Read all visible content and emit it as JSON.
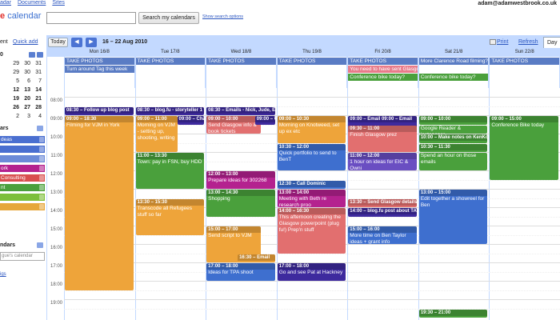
{
  "topnav": {
    "links": [
      "adar",
      "Documents",
      "Sites"
    ],
    "user_email": "adam@adamwestbrook.co.uk"
  },
  "header": {
    "logo_g": "e",
    "logo_text": "calendar",
    "search_button": "Search my calendars",
    "search_options": "Show search options"
  },
  "left": {
    "top_left": "ent",
    "quick_add": "Quick add",
    "mini_month": "0",
    "mini_rows": [
      [
        "29",
        "30",
        "31"
      ],
      [
        "29",
        "30",
        "31"
      ],
      [
        "5",
        "6",
        "7"
      ],
      [
        "12",
        "13",
        "14"
      ],
      [
        "19",
        "20",
        "21"
      ],
      [
        "26",
        "27",
        "28"
      ],
      [
        "2",
        "3",
        "4"
      ]
    ],
    "section_my": "ars",
    "calendars": [
      {
        "label": "deas",
        "color": "#4a6fd0"
      },
      {
        "label": "",
        "color": "#4a6fd0"
      },
      {
        "label": "",
        "color": "#6c8bd8"
      },
      {
        "label": "ork",
        "color": "#b4228f"
      },
      {
        "label": "Consulting",
        "color": "#d94f4f"
      },
      {
        "label": "nt",
        "color": "#4aa03c"
      },
      {
        "label": "",
        "color": "#7cbf3b"
      },
      {
        "label": "",
        "color": "#e6a73a"
      }
    ],
    "section_other": "ndars",
    "other_placeholder": "gue's calendar",
    "settings_link": "igs"
  },
  "toolbar": {
    "today": "Today",
    "prev": "◀",
    "next": "▶",
    "date_range": "16 – 22 Aug 2010",
    "print": "Print",
    "refresh": "Refresh",
    "day_tab": "Day"
  },
  "days": [
    "Mon 16/8",
    "Tue 17/8",
    "Wed 18/8",
    "Thu 19/8",
    "Fri 20/8",
    "Sat 21/8",
    "Sun 22/8"
  ],
  "times": [
    "08:00",
    "09:00",
    "10:00",
    "11:00",
    "12:00",
    "13:00",
    "14:00",
    "15:00",
    "16:00",
    "17:00",
    "18:00",
    "19:00"
  ],
  "allday": [
    {
      "day": 0,
      "row": 0,
      "text": "TAKE PHOTOS",
      "color": "#5a7cc4"
    },
    {
      "day": 0,
      "row": 1,
      "text": "Turn around Tag this week",
      "color": "#5a7cc4"
    },
    {
      "day": 1,
      "row": 0,
      "text": "TAKE PHOTOS",
      "color": "#5a7cc4"
    },
    {
      "day": 2,
      "row": 0,
      "text": "TAKE PHOTOS",
      "color": "#5a7cc4"
    },
    {
      "day": 3,
      "row": 0,
      "text": "TAKE PHOTOS",
      "color": "#5a7cc4"
    },
    {
      "day": 4,
      "row": 0,
      "text": "TAKE PHOTOS",
      "color": "#5a7cc4"
    },
    {
      "day": 4,
      "row": 1,
      "text": "You need to have sent Glasgow",
      "color": "#e87b8a"
    },
    {
      "day": 4,
      "row": 2,
      "text": "Conference bike today?",
      "color": "#4aa03c"
    },
    {
      "day": 5,
      "row": 0,
      "text": "More Clarence Road filming?",
      "color": "#5a7cc4"
    },
    {
      "day": 5,
      "row": 2,
      "text": "Conference bike today?",
      "color": "#4aa03c"
    },
    {
      "day": 6,
      "row": 0,
      "text": "TAKE PHOTOS",
      "color": "#5a7cc4"
    }
  ],
  "events": [
    {
      "day": 0,
      "start": 8.5,
      "end": 9.0,
      "hdr": "08:30 – Follow up blog post",
      "body": "",
      "color": "#3e2a9e"
    },
    {
      "day": 0,
      "start": 9.0,
      "end": 18.5,
      "hdr": "09:00 – 18:30",
      "body": "Filming for VJM in York",
      "color": "#eea43a"
    },
    {
      "day": 1,
      "start": 8.5,
      "end": 9.0,
      "hdr": "08:30 – blog.fu - storyteller 1",
      "body": "",
      "color": "#3e2a9e"
    },
    {
      "day": 1,
      "start": 9.0,
      "end": 11.0,
      "hdr": "09:00 – 11:00",
      "body": "Morning on VJM - setting up, shooting, writing",
      "color": "#eea43a",
      "w": 0.62
    },
    {
      "day": 1,
      "start": 9.0,
      "end": 9.5,
      "hdr": "09:00 – Chase E",
      "body": "",
      "color": "#3e2a9e",
      "x": 0.6,
      "w": 0.4
    },
    {
      "day": 1,
      "start": 11.0,
      "end": 13.0,
      "hdr": "11:00 – 13:30",
      "body": "Town: pay in FSN, buy HDD",
      "color": "#4aa03c"
    },
    {
      "day": 1,
      "start": 13.5,
      "end": 15.5,
      "hdr": "13:30 – 15:30",
      "body": "Transcode all Refugees stuff so far",
      "color": "#eea43a"
    },
    {
      "day": 2,
      "start": 8.5,
      "end": 9.0,
      "hdr": "08:30 – Emails - Nick, Jude, Est",
      "body": "",
      "color": "#3e2a9e"
    },
    {
      "day": 2,
      "start": 9.0,
      "end": 10.0,
      "hdr": "09:00 – 10:00",
      "body": "Send Glasgow info & book tickets",
      "color": "#e26f6f",
      "w": 0.8
    },
    {
      "day": 2,
      "start": 9.0,
      "end": 9.5,
      "hdr": "09:00 – Chase D",
      "body": "",
      "color": "#3e2a9e",
      "x": 0.7,
      "w": 0.3
    },
    {
      "day": 2,
      "start": 12.0,
      "end": 13.0,
      "hdr": "12:00 – 13:00",
      "body": "Prepare ideas for 302268",
      "color": "#b4228f"
    },
    {
      "day": 2,
      "start": 13.0,
      "end": 14.5,
      "hdr": "13:00 – 14:30",
      "body": "Shopping",
      "color": "#4aa03c"
    },
    {
      "day": 2,
      "start": 15.0,
      "end": 17.0,
      "hdr": "15:00 – 17:00",
      "body": "Send script to VJM",
      "color": "#eea43a",
      "w": 0.8
    },
    {
      "day": 2,
      "start": 16.5,
      "end": 17.0,
      "hdr": "16:30 – Email",
      "body": "",
      "color": "#eea43a",
      "x": 0.45,
      "w": 0.55
    },
    {
      "day": 2,
      "start": 17.0,
      "end": 18.0,
      "hdr": "17:00 – 18:00",
      "body": "Ideas for TPA shoot",
      "color": "#3e6fcf"
    },
    {
      "day": 3,
      "start": 9.0,
      "end": 10.5,
      "hdr": "09:00 – 10:30",
      "body": "Morning on Knotweed, set up ex etc",
      "color": "#eea43a"
    },
    {
      "day": 3,
      "start": 10.5,
      "end": 12.0,
      "hdr": "10:30 – 12:00",
      "body": "Quick portfolio to send to BenT",
      "color": "#3e6fcf"
    },
    {
      "day": 3,
      "start": 12.5,
      "end": 13.0,
      "hdr": "12:30 – Call Dominic",
      "body": "",
      "color": "#3e6fcf"
    },
    {
      "day": 3,
      "start": 13.0,
      "end": 14.0,
      "hdr": "13:00 – 14:00",
      "body": "Meeting with Beth re research proo",
      "color": "#b4228f"
    },
    {
      "day": 3,
      "start": 14.0,
      "end": 16.5,
      "hdr": "14:00 – 16:30",
      "body": "This afternoon creating the Glasgow powerpoint (plug fu!) Prep'n stuff",
      "color": "#e26f6f"
    },
    {
      "day": 3,
      "start": 17.0,
      "end": 18.0,
      "hdr": "17:00 – 18:00",
      "body": "Go and see Pat at Hackney",
      "color": "#3e2a9e"
    },
    {
      "day": 4,
      "start": 9.0,
      "end": 10.0,
      "hdr": "09:00 – Email  09:00 – Email",
      "body": "",
      "color": "#3e2a9e"
    },
    {
      "day": 4,
      "start": 9.5,
      "end": 11.0,
      "hdr": "09:30 – 11:00",
      "body": "Finish Glasgow prez",
      "color": "#e26f6f"
    },
    {
      "day": 4,
      "start": 11.0,
      "end": 12.0,
      "hdr": "11:00 – 12:00",
      "body": "1 hour on ideas for EIC & Owni",
      "color": "#6a4ec2"
    },
    {
      "day": 4,
      "start": 13.5,
      "end": 14.0,
      "hdr": "13:30 – Send Glasgow details to Paul",
      "body": "",
      "color": "#e26f6f"
    },
    {
      "day": 4,
      "start": 14.0,
      "end": 14.5,
      "hdr": "14:00 – blog.fu post about TAL",
      "body": "",
      "color": "#3e2a9e"
    },
    {
      "day": 4,
      "start": 15.0,
      "end": 16.0,
      "hdr": "15:00 – 16:00",
      "body": "More time on Ben Taylor ideas + grant info",
      "color": "#3e6fcf"
    },
    {
      "day": 5,
      "start": 9.0,
      "end": 9.5,
      "hdr": "09:00 – 10:00",
      "body": "",
      "color": "#4aa03c"
    },
    {
      "day": 5,
      "start": 9.5,
      "end": 10.0,
      "hdr": "",
      "body": "Google Reader & instapaper",
      "color": "#4aa03c"
    },
    {
      "day": 5,
      "start": 10.0,
      "end": 10.5,
      "hdr": "10:00 – Make notes on KenKob",
      "body": "",
      "color": "#4aa03c"
    },
    {
      "day": 5,
      "start": 10.5,
      "end": 11.0,
      "hdr": "10:30 – 11:30",
      "body": "",
      "color": "#4aa03c"
    },
    {
      "day": 5,
      "start": 11.0,
      "end": 12.0,
      "hdr": "",
      "body": "Spend an hour on those emails",
      "color": "#4aa03c"
    },
    {
      "day": 5,
      "start": 13.0,
      "end": 16.0,
      "hdr": "13:00 – 15:00",
      "body": "Edit together a showreel for Ben",
      "color": "#3e6fcf"
    },
    {
      "day": 5,
      "start": 19.5,
      "end": 20.0,
      "hdr": "19:30 – 21:00",
      "body": "",
      "color": "#4aa03c"
    },
    {
      "day": 6,
      "start": 9.0,
      "end": 12.5,
      "hdr": "09:00 – 15:00",
      "body": "Conference Bike today",
      "color": "#4aa03c"
    }
  ]
}
